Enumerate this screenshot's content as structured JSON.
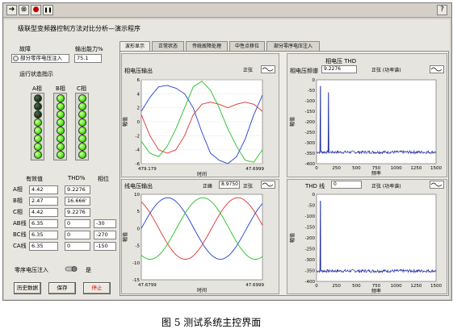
{
  "app_title": "级联型变频器控制方法对比分析—演示程序",
  "toolbar": {
    "run": "➔",
    "run_cont": "⊗",
    "abort": "●",
    "pause": "❚❚",
    "help": "?"
  },
  "left": {
    "mode_label": "故障",
    "mode_value": "部分零序电压注入",
    "cap_label": "输出能力%",
    "cap_value": "75.1",
    "status_label": "运行状态指示",
    "phase_labels": [
      "A相",
      "B相",
      "C相"
    ],
    "leds": [
      [
        "off",
        "off",
        "off",
        "on",
        "on",
        "on",
        "on",
        "on"
      ],
      [
        "on",
        "on",
        "on",
        "on",
        "on",
        "on",
        "on",
        "on"
      ],
      [
        "on",
        "on",
        "on",
        "on",
        "on",
        "on",
        "on",
        "on"
      ]
    ],
    "rms_header": "有效值",
    "thd_header": "THD%",
    "angle_header": "相位",
    "rows": [
      {
        "label": "A相",
        "rms": "4.42",
        "thd": "9.2276",
        "angle": ""
      },
      {
        "label": "B相",
        "rms": "2.47",
        "thd": "16.666'",
        "angle": ""
      },
      {
        "label": "C相",
        "rms": "4.42",
        "thd": "9.2276",
        "angle": ""
      },
      {
        "label": "AB线",
        "rms": "6.35",
        "thd": "0",
        "angle": "-30"
      },
      {
        "label": "BC线",
        "rms": "6.35",
        "thd": "0",
        "angle": "-270"
      },
      {
        "label": "CA线",
        "rms": "6.35",
        "thd": "0",
        "angle": "-150"
      }
    ],
    "zero_seq_label": "零序电压注入",
    "zero_seq_state": "是",
    "btn_history": "历史数据",
    "btn_save": "保存",
    "btn_stop": "停止"
  },
  "tabs": [
    "波形显示",
    "正常状态",
    "传统故障处理",
    "中性点移位",
    "部分零序电压注入"
  ],
  "charts": {
    "phase_wave": {
      "title": "相电压输出",
      "mode": "正弦",
      "ylabel": "幅值",
      "xlabel": "时间",
      "xmin": "479.179",
      "xmax": "47.6999"
    },
    "phase_spec": {
      "top_label": "相电压 THD",
      "title": "相电压频谱",
      "thd_value": "9.2276",
      "mode": "正弦 (功率谱)",
      "ylabel": "幅值",
      "xlabel": "频率"
    },
    "line_wave": {
      "title": "线电压输出",
      "peak_label": "正峰",
      "peak_value": "8.9750",
      "mode": "正弦",
      "ylabel": "幅值",
      "xlabel": "时间",
      "xmin": "47.6799",
      "xmax": "47.6999"
    },
    "line_spec": {
      "title": "THD 线",
      "thd_value": "0",
      "mode": "正弦 (功率谱)",
      "ylabel": "幅值",
      "xlabel": "频率"
    }
  },
  "chart_data": [
    {
      "type": "line",
      "ylim": [
        -6,
        6
      ],
      "yticks": [
        "6",
        "4",
        "2",
        "0",
        "-2",
        "-4",
        "-6"
      ],
      "series": [
        {
          "color": "#2040d0",
          "values": [
            1.5,
            3.5,
            5.0,
            5.2,
            4.8,
            4.0,
            2.0,
            -1.5,
            -4.5,
            -5.5,
            -6.0,
            -5.0,
            -2.5,
            1.0,
            3.8
          ]
        },
        {
          "color": "#e03030",
          "values": [
            1.0,
            -2.0,
            -4.0,
            -4.5,
            -4.0,
            -2.0,
            1.0,
            2.5,
            2.8,
            2.5,
            2.0,
            2.5,
            2.8,
            2.5,
            1.5
          ]
        },
        {
          "color": "#20c020",
          "values": [
            -2.8,
            -4.5,
            -5.0,
            -3.5,
            -1.0,
            2.0,
            5.0,
            5.8,
            4.5,
            2.0,
            -1.0,
            -3.5,
            -5.5,
            -5.8,
            -4.0
          ]
        }
      ]
    },
    {
      "type": "line",
      "xlim": [
        0,
        1500
      ],
      "ylim": [
        -400,
        0
      ],
      "xticks": [
        "0",
        "250",
        "500",
        "750",
        "1000",
        "1250",
        "1500"
      ],
      "yticks": [
        "0",
        "-50",
        "-100",
        "-150",
        "-200",
        "-250",
        "-300",
        "-350",
        "-400"
      ],
      "peaks": [
        {
          "x": 50,
          "y": -30
        },
        {
          "x": 150,
          "y": -60
        }
      ],
      "noise_floor": -345
    },
    {
      "type": "line",
      "ylim": [
        -15,
        10
      ],
      "yticks": [
        "10",
        "5",
        "0",
        "-5",
        "-10",
        "-15"
      ],
      "series": [
        {
          "color": "#2040d0",
          "phase": 0
        },
        {
          "color": "#e03030",
          "phase": 2.094
        },
        {
          "color": "#20c020",
          "phase": 4.189
        }
      ],
      "amplitude": 9
    },
    {
      "type": "line",
      "xlim": [
        0,
        1500
      ],
      "ylim": [
        -400,
        0
      ],
      "xticks": [
        "0",
        "250",
        "500",
        "750",
        "1000",
        "1250",
        "1500"
      ],
      "yticks": [
        "0",
        "-50",
        "-100",
        "-150",
        "-200",
        "-250",
        "-300",
        "-350",
        "-400"
      ],
      "peaks": [
        {
          "x": 50,
          "y": -30
        }
      ],
      "noise_floor": -352
    }
  ],
  "caption": "图 5  测试系统主控界面"
}
